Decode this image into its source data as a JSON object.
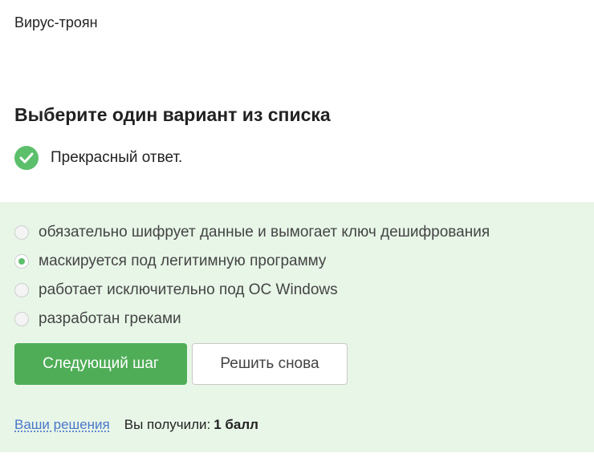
{
  "question": {
    "text": "Вирус-троян"
  },
  "section": {
    "title": "Выберите один вариант из списка"
  },
  "feedback": {
    "text": "Прекрасный ответ."
  },
  "options": [
    {
      "label": "обязательно шифрует данные и вымогает ключ дешифрования",
      "selected": false
    },
    {
      "label": "маскируется под легитимную программу",
      "selected": true
    },
    {
      "label": "работает исключительно под ОС Windows",
      "selected": false
    },
    {
      "label": "разработан греками",
      "selected": false
    }
  ],
  "buttons": {
    "next_label": "Следующий шаг",
    "retry_label": "Решить снова"
  },
  "footer": {
    "solutions_link": "Ваши решения",
    "score_label": "Вы получили:",
    "score_value": "1 балл"
  },
  "colors": {
    "accent": "#4fad57",
    "panel_bg": "#e8f6e8",
    "link": "#4a77c9"
  }
}
